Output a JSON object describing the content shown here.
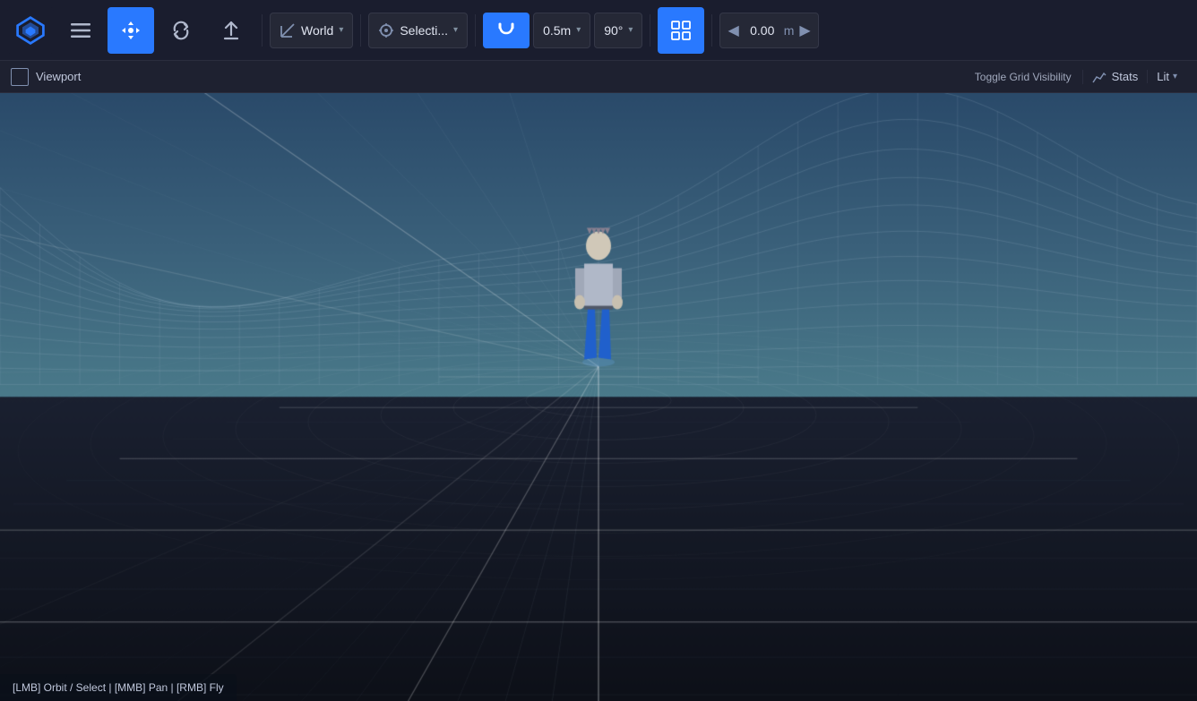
{
  "logo": {
    "alt": "PixoVR Logo"
  },
  "toolbar": {
    "menu_label": "☰",
    "move_label": "✛",
    "refresh_label": "↺",
    "up_arrow_label": "↑",
    "axis_icon": "↗",
    "world_label": "World",
    "world_caret": "▾",
    "target_icon": "⊙",
    "selection_label": "Selecti...",
    "selection_caret": "▾",
    "magnet_label": "⊓",
    "snap_label": "0.5m",
    "snap_caret": "▾",
    "angle_label": "90°",
    "angle_caret": "▾",
    "grid_icon": "⊞",
    "coord_prev": "◀",
    "coord_value": "0.00",
    "coord_unit": "m",
    "coord_next": "▶"
  },
  "viewport_bar": {
    "title": "Viewport",
    "toggle_grid": "Toggle Grid Visibility",
    "stats_label": "Stats",
    "lit_label": "Lit",
    "lit_caret": "▾"
  },
  "viewport": {
    "controls_hint": "[LMB] Orbit / Select | [MMB] Pan | [RMB] Fly"
  }
}
